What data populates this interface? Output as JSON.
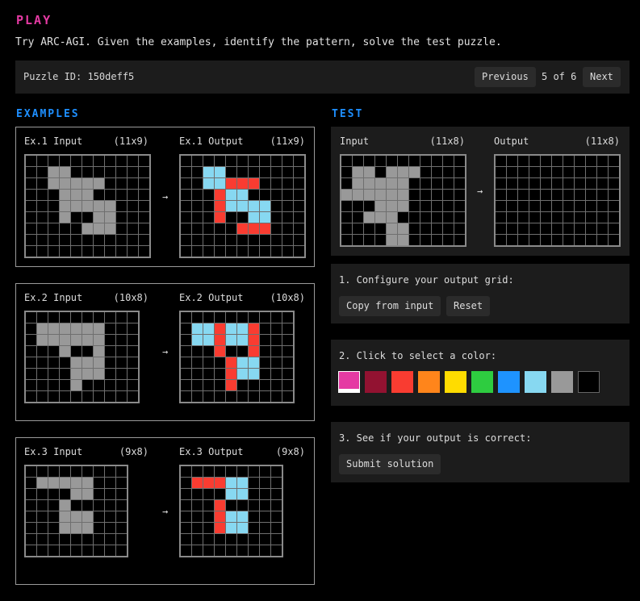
{
  "header": {
    "title": "PLAY",
    "subtitle": "Try ARC-AGI. Given the examples, identify the pattern, solve the test puzzle."
  },
  "puzzle_bar": {
    "puzzle_id": "Puzzle ID: 150deff5",
    "previous_label": "Previous",
    "page_count": "5 of 6",
    "next_label": "Next"
  },
  "colors": [
    "#000000",
    "#1e93ff",
    "#f93c31",
    "#4fcc30",
    "#ffdc00",
    "#999999",
    "#e53aa3",
    "#ff851b",
    "#87d8f1",
    "#921231"
  ],
  "examples_title": "EXAMPLES",
  "examples": [
    {
      "input_label": "Ex.1 Input",
      "input_size": "(11x9)",
      "output_label": "Ex.1 Output",
      "output_size": "(11x9)",
      "input": [
        [
          0,
          0,
          0,
          0,
          0,
          0,
          0,
          0,
          0,
          0,
          0
        ],
        [
          0,
          0,
          5,
          5,
          0,
          0,
          0,
          0,
          0,
          0,
          0
        ],
        [
          0,
          0,
          5,
          5,
          5,
          5,
          5,
          0,
          0,
          0,
          0
        ],
        [
          0,
          0,
          0,
          5,
          5,
          5,
          0,
          0,
          0,
          0,
          0
        ],
        [
          0,
          0,
          0,
          5,
          5,
          5,
          5,
          5,
          0,
          0,
          0
        ],
        [
          0,
          0,
          0,
          5,
          0,
          0,
          5,
          5,
          0,
          0,
          0
        ],
        [
          0,
          0,
          0,
          0,
          0,
          5,
          5,
          5,
          0,
          0,
          0
        ],
        [
          0,
          0,
          0,
          0,
          0,
          0,
          0,
          0,
          0,
          0,
          0
        ],
        [
          0,
          0,
          0,
          0,
          0,
          0,
          0,
          0,
          0,
          0,
          0
        ]
      ],
      "output": [
        [
          0,
          0,
          0,
          0,
          0,
          0,
          0,
          0,
          0,
          0,
          0
        ],
        [
          0,
          0,
          8,
          8,
          0,
          0,
          0,
          0,
          0,
          0,
          0
        ],
        [
          0,
          0,
          8,
          8,
          2,
          2,
          2,
          0,
          0,
          0,
          0
        ],
        [
          0,
          0,
          0,
          2,
          8,
          8,
          0,
          0,
          0,
          0,
          0
        ],
        [
          0,
          0,
          0,
          2,
          8,
          8,
          8,
          8,
          0,
          0,
          0
        ],
        [
          0,
          0,
          0,
          2,
          0,
          0,
          8,
          8,
          0,
          0,
          0
        ],
        [
          0,
          0,
          0,
          0,
          0,
          2,
          2,
          2,
          0,
          0,
          0
        ],
        [
          0,
          0,
          0,
          0,
          0,
          0,
          0,
          0,
          0,
          0,
          0
        ],
        [
          0,
          0,
          0,
          0,
          0,
          0,
          0,
          0,
          0,
          0,
          0
        ]
      ]
    },
    {
      "input_label": "Ex.2 Input",
      "input_size": "(10x8)",
      "output_label": "Ex.2 Output",
      "output_size": "(10x8)",
      "input": [
        [
          0,
          0,
          0,
          0,
          0,
          0,
          0,
          0,
          0,
          0
        ],
        [
          0,
          5,
          5,
          5,
          5,
          5,
          5,
          0,
          0,
          0
        ],
        [
          0,
          5,
          5,
          5,
          5,
          5,
          5,
          0,
          0,
          0
        ],
        [
          0,
          0,
          0,
          5,
          0,
          0,
          5,
          0,
          0,
          0
        ],
        [
          0,
          0,
          0,
          0,
          5,
          5,
          5,
          0,
          0,
          0
        ],
        [
          0,
          0,
          0,
          0,
          5,
          5,
          5,
          0,
          0,
          0
        ],
        [
          0,
          0,
          0,
          0,
          5,
          0,
          0,
          0,
          0,
          0
        ],
        [
          0,
          0,
          0,
          0,
          0,
          0,
          0,
          0,
          0,
          0
        ]
      ],
      "output": [
        [
          0,
          0,
          0,
          0,
          0,
          0,
          0,
          0,
          0,
          0
        ],
        [
          0,
          8,
          8,
          2,
          8,
          8,
          2,
          0,
          0,
          0
        ],
        [
          0,
          8,
          8,
          2,
          8,
          8,
          2,
          0,
          0,
          0
        ],
        [
          0,
          0,
          0,
          2,
          0,
          0,
          2,
          0,
          0,
          0
        ],
        [
          0,
          0,
          0,
          0,
          2,
          8,
          8,
          0,
          0,
          0
        ],
        [
          0,
          0,
          0,
          0,
          2,
          8,
          8,
          0,
          0,
          0
        ],
        [
          0,
          0,
          0,
          0,
          2,
          0,
          0,
          0,
          0,
          0
        ],
        [
          0,
          0,
          0,
          0,
          0,
          0,
          0,
          0,
          0,
          0
        ]
      ]
    },
    {
      "input_label": "Ex.3 Input",
      "input_size": "(9x8)",
      "output_label": "Ex.3 Output",
      "output_size": "(9x8)",
      "input": [
        [
          0,
          0,
          0,
          0,
          0,
          0,
          0,
          0,
          0
        ],
        [
          0,
          5,
          5,
          5,
          5,
          5,
          0,
          0,
          0
        ],
        [
          0,
          0,
          0,
          0,
          5,
          5,
          0,
          0,
          0
        ],
        [
          0,
          0,
          0,
          5,
          0,
          0,
          0,
          0,
          0
        ],
        [
          0,
          0,
          0,
          5,
          5,
          5,
          0,
          0,
          0
        ],
        [
          0,
          0,
          0,
          5,
          5,
          5,
          0,
          0,
          0
        ],
        [
          0,
          0,
          0,
          0,
          0,
          0,
          0,
          0,
          0
        ],
        [
          0,
          0,
          0,
          0,
          0,
          0,
          0,
          0,
          0
        ]
      ],
      "output": [
        [
          0,
          0,
          0,
          0,
          0,
          0,
          0,
          0,
          0
        ],
        [
          0,
          2,
          2,
          2,
          8,
          8,
          0,
          0,
          0
        ],
        [
          0,
          0,
          0,
          0,
          8,
          8,
          0,
          0,
          0
        ],
        [
          0,
          0,
          0,
          2,
          0,
          0,
          0,
          0,
          0
        ],
        [
          0,
          0,
          0,
          2,
          8,
          8,
          0,
          0,
          0
        ],
        [
          0,
          0,
          0,
          2,
          8,
          8,
          0,
          0,
          0
        ],
        [
          0,
          0,
          0,
          0,
          0,
          0,
          0,
          0,
          0
        ],
        [
          0,
          0,
          0,
          0,
          0,
          0,
          0,
          0,
          0
        ]
      ]
    }
  ],
  "test_title": "TEST",
  "test": {
    "input_label": "Input",
    "input_size": "(11x8)",
    "output_label": "Output",
    "output_size": "(11x8)",
    "input": [
      [
        0,
        0,
        0,
        0,
        0,
        0,
        0,
        0,
        0,
        0,
        0
      ],
      [
        0,
        5,
        5,
        0,
        5,
        5,
        5,
        0,
        0,
        0,
        0
      ],
      [
        0,
        5,
        5,
        5,
        5,
        5,
        0,
        0,
        0,
        0,
        0
      ],
      [
        5,
        5,
        5,
        5,
        5,
        5,
        0,
        0,
        0,
        0,
        0
      ],
      [
        0,
        0,
        0,
        5,
        5,
        5,
        0,
        0,
        0,
        0,
        0
      ],
      [
        0,
        0,
        5,
        5,
        5,
        0,
        0,
        0,
        0,
        0,
        0
      ],
      [
        0,
        0,
        0,
        0,
        5,
        5,
        0,
        0,
        0,
        0,
        0
      ],
      [
        0,
        0,
        0,
        0,
        5,
        5,
        0,
        0,
        0,
        0,
        0
      ]
    ],
    "output": [
      [
        0,
        0,
        0,
        0,
        0,
        0,
        0,
        0,
        0,
        0,
        0
      ],
      [
        0,
        0,
        0,
        0,
        0,
        0,
        0,
        0,
        0,
        0,
        0
      ],
      [
        0,
        0,
        0,
        0,
        0,
        0,
        0,
        0,
        0,
        0,
        0
      ],
      [
        0,
        0,
        0,
        0,
        0,
        0,
        0,
        0,
        0,
        0,
        0
      ],
      [
        0,
        0,
        0,
        0,
        0,
        0,
        0,
        0,
        0,
        0,
        0
      ],
      [
        0,
        0,
        0,
        0,
        0,
        0,
        0,
        0,
        0,
        0,
        0
      ],
      [
        0,
        0,
        0,
        0,
        0,
        0,
        0,
        0,
        0,
        0,
        0
      ],
      [
        0,
        0,
        0,
        0,
        0,
        0,
        0,
        0,
        0,
        0,
        0
      ]
    ]
  },
  "arrow": "→",
  "step1": {
    "text": "1. Configure your output grid:",
    "copy_label": "Copy from input",
    "reset_label": "Reset"
  },
  "step2": {
    "text": "2. Click to select a color:"
  },
  "palette": [
    "#e53aa3",
    "#921231",
    "#f93c31",
    "#ff851b",
    "#ffdc00",
    "#2ecc40",
    "#1e93ff",
    "#87d8f1",
    "#999999",
    "#000000"
  ],
  "palette_names": [
    "magenta",
    "maroon",
    "red",
    "orange",
    "yellow",
    "green",
    "blue",
    "light-blue",
    "gray",
    "black"
  ],
  "selected_color": "magenta",
  "step3": {
    "text": "3. See if your output is correct:",
    "submit_label": "Submit solution"
  }
}
